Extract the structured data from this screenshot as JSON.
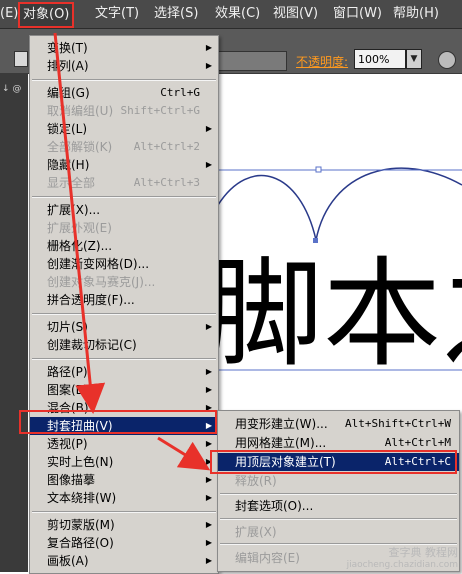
{
  "menubar": {
    "left_stub": "(E)",
    "items": [
      "对象(O)",
      "文字(T)",
      "选择(S)",
      "效果(C)",
      "视图(V)",
      "窗口(W)",
      "帮助(H)"
    ]
  },
  "toolbar": {
    "opacity_label": "不透明度:",
    "opacity_value": "100%",
    "left_stub": "↓ @"
  },
  "canvas": {
    "artwork_text": "脚本之家"
  },
  "object_menu": {
    "items": [
      {
        "label": "变换(T)",
        "shortcut": "",
        "submenu": true,
        "disabled": false
      },
      {
        "label": "排列(A)",
        "shortcut": "",
        "submenu": true,
        "disabled": false
      },
      {
        "label": "编组(G)",
        "shortcut": "Ctrl+G",
        "submenu": false,
        "disabled": false
      },
      {
        "label": "取消编组(U)",
        "shortcut": "Shift+Ctrl+G",
        "submenu": false,
        "disabled": true
      },
      {
        "label": "锁定(L)",
        "shortcut": "",
        "submenu": true,
        "disabled": false
      },
      {
        "label": "全部解锁(K)",
        "shortcut": "Alt+Ctrl+2",
        "submenu": false,
        "disabled": true
      },
      {
        "label": "隐藏(H)",
        "shortcut": "",
        "submenu": true,
        "disabled": false
      },
      {
        "label": "显示全部",
        "shortcut": "Alt+Ctrl+3",
        "submenu": false,
        "disabled": true
      },
      {
        "label": "扩展(X)...",
        "shortcut": "",
        "submenu": false,
        "disabled": false
      },
      {
        "label": "扩展外观(E)",
        "shortcut": "",
        "submenu": false,
        "disabled": true
      },
      {
        "label": "栅格化(Z)...",
        "shortcut": "",
        "submenu": false,
        "disabled": false
      },
      {
        "label": "创建渐变网格(D)...",
        "shortcut": "",
        "submenu": false,
        "disabled": false
      },
      {
        "label": "创建对象马赛克(J)...",
        "shortcut": "",
        "submenu": false,
        "disabled": true
      },
      {
        "label": "拼合透明度(F)...",
        "shortcut": "",
        "submenu": false,
        "disabled": false
      },
      {
        "label": "切片(S)",
        "shortcut": "",
        "submenu": true,
        "disabled": false
      },
      {
        "label": "创建裁切标记(C)",
        "shortcut": "",
        "submenu": false,
        "disabled": false
      },
      {
        "label": "路径(P)",
        "shortcut": "",
        "submenu": true,
        "disabled": false
      },
      {
        "label": "图案(E)",
        "shortcut": "",
        "submenu": true,
        "disabled": false
      },
      {
        "label": "混合(B)",
        "shortcut": "",
        "submenu": true,
        "disabled": false
      },
      {
        "label": "封套扭曲(V)",
        "shortcut": "",
        "submenu": true,
        "disabled": false,
        "highlighted": true
      },
      {
        "label": "透视(P)",
        "shortcut": "",
        "submenu": true,
        "disabled": false
      },
      {
        "label": "实时上色(N)",
        "shortcut": "",
        "submenu": true,
        "disabled": false
      },
      {
        "label": "图像描摹",
        "shortcut": "",
        "submenu": true,
        "disabled": false
      },
      {
        "label": "文本绕排(W)",
        "shortcut": "",
        "submenu": true,
        "disabled": false
      },
      {
        "label": "剪切蒙版(M)",
        "shortcut": "",
        "submenu": true,
        "disabled": false
      },
      {
        "label": "复合路径(O)",
        "shortcut": "",
        "submenu": true,
        "disabled": false
      },
      {
        "label": "画板(A)",
        "shortcut": "",
        "submenu": true,
        "disabled": false
      }
    ]
  },
  "envelope_submenu": {
    "items": [
      {
        "label": "用变形建立(W)...",
        "shortcut": "Alt+Shift+Ctrl+W",
        "disabled": false
      },
      {
        "label": "用网格建立(M)...",
        "shortcut": "Alt+Ctrl+M",
        "disabled": false
      },
      {
        "label": "用顶层对象建立(T)",
        "shortcut": "Alt+Ctrl+C",
        "disabled": false,
        "highlighted": true
      },
      {
        "label": "释放(R)",
        "shortcut": "",
        "disabled": true
      },
      {
        "label": "封套选项(O)...",
        "shortcut": "",
        "disabled": false
      },
      {
        "label": "扩展(X)",
        "shortcut": "",
        "disabled": true
      },
      {
        "label": "编辑内容(E)",
        "shortcut": "",
        "disabled": true
      }
    ]
  },
  "watermark": {
    "line1": "查字典 教程网",
    "line2": "jiaocheng.chazidian.com"
  },
  "colors": {
    "highlight": "#0a246a",
    "annotation_red": "#e8312a",
    "menu_bg": "#d6d3ce",
    "opacity_label": "#ff9a1f"
  }
}
